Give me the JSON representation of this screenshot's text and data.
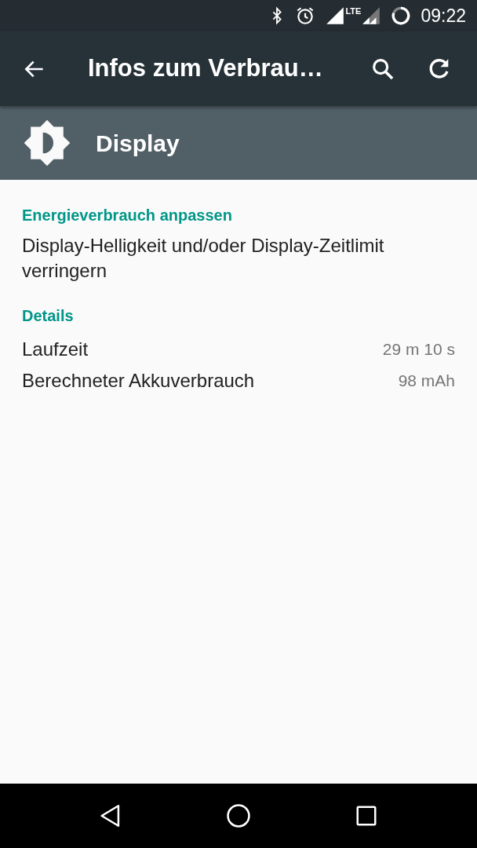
{
  "status_bar": {
    "network_type": "LTE",
    "time": "09:22"
  },
  "toolbar": {
    "title": "Infos zum Verbrau…"
  },
  "header": {
    "title": "Display"
  },
  "sections": [
    {
      "title": "Energieverbrauch anpassen",
      "items": [
        {
          "kind": "text",
          "text": "Display-Helligkeit und/oder Display-Zeitlimit verringern"
        }
      ]
    },
    {
      "title": "Details",
      "items": [
        {
          "kind": "row",
          "label": "Laufzeit",
          "value": "29 m 10 s"
        },
        {
          "kind": "row",
          "label": "Berechneter Akkuverbrauch",
          "value": "98 mAh"
        }
      ]
    }
  ]
}
